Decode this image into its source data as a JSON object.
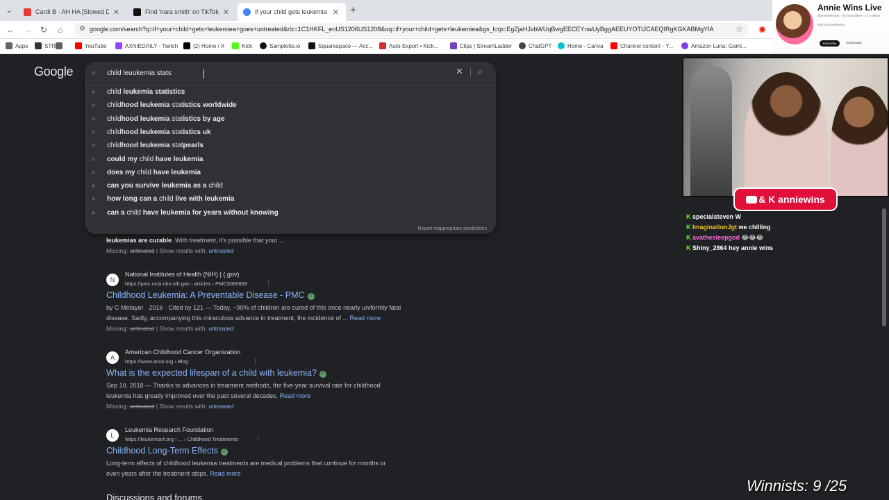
{
  "tabs": [
    {
      "title": "Cardi B - AH HA [Slowed Down",
      "color": "#e53935"
    },
    {
      "title": "Find 'nara smith' on TikTok | Tik",
      "color": "#111111"
    },
    {
      "title": "if your child gets leukemia go",
      "color": "#4285f4"
    }
  ],
  "toolbar": {
    "url": "google.com/search?q=if+your+child+gets+leukemiea+goes+untreated&rlz=1C1HKFL_enUS1206US1208&oq=if+your+child+gets+leukemiea&gs_lcrp=EgZjaHJvbWUqBwgEECEYnwUyBggAEEUYOTIJCAEQIRgKGKABMgYIA"
  },
  "bookmarks": [
    {
      "label": "Apps",
      "color": "#5f6368"
    },
    {
      "label": "STR",
      "color": "#333333"
    },
    {
      "label": "",
      "color": "#5f6368"
    },
    {
      "label": "YouTube",
      "color": "#ff0000"
    },
    {
      "label": "AXNIEDAILY - Twitch",
      "color": "#9146ff"
    },
    {
      "label": "(2) Home / X",
      "color": "#000000"
    },
    {
      "label": "Kick",
      "color": "#53fc18"
    },
    {
      "label": "Samplette.io",
      "color": "#111111"
    },
    {
      "label": "Squarespace — Acc...",
      "color": "#111111"
    },
    {
      "label": "Auto-Export • Kick...",
      "color": "#d32f2f"
    },
    {
      "label": "Clips | StreamLadder",
      "color": "#6f42c1"
    },
    {
      "label": "ChatGPT",
      "color": "#444444"
    },
    {
      "label": "Home - Canva",
      "color": "#00c4cc"
    },
    {
      "label": "Channel content - Y...",
      "color": "#ff0000"
    },
    {
      "label": "Amazon Luna: Gami...",
      "color": "#7b3fe4"
    }
  ],
  "google": {
    "logo": "Google",
    "query": "child leuukemia stats",
    "suggestions": [
      {
        "pre": "child ",
        "bold": "leukemia stat",
        "pre2": "",
        "bold2": "istics",
        "rest": ""
      },
      {
        "pre": "child",
        "bold": "hood leukemia",
        "pre2": " stat",
        "bold2": "istics worldwide",
        "rest": ""
      },
      {
        "pre": "child",
        "bold": "hood leukemia",
        "pre2": " stat",
        "bold2": "istics by age",
        "rest": ""
      },
      {
        "pre": "child",
        "bold": "hood leukemia",
        "pre2": " stat",
        "bold2": "istics uk",
        "rest": ""
      },
      {
        "pre": "child",
        "bold": "hood leukemia",
        "pre2": " stat",
        "bold2": "pearls",
        "rest": ""
      },
      {
        "pre": "",
        "bold": "could my ",
        "pre2": "child",
        "bold2": " have leukemia",
        "rest": ""
      },
      {
        "pre": "",
        "bold": "does my ",
        "pre2": "child",
        "bold2": " have leukemia",
        "rest": ""
      },
      {
        "pre": "",
        "bold": "can you survive leukemia as a ",
        "pre2": "child",
        "bold2": "",
        "rest": ""
      },
      {
        "pre": "",
        "bold": "how long can a ",
        "pre2": "child",
        "bold2": " live with leukemia",
        "rest": ""
      },
      {
        "pre": "",
        "bold": "can a ",
        "pre2": "child",
        "bold2": " have leukemia for years without knowing",
        "rest": ""
      }
    ],
    "report": "Report inappropriate predictions"
  },
  "results": {
    "top_snippet": {
      "bold": "leukemias are curable",
      "rest": ". With treatment, it's possible that your ..."
    },
    "missing_label": "Missing:",
    "missing_word": "untreated",
    "show_label": "| Show results with:",
    "items": [
      {
        "site": "National Institutes of Health (NIH) | (.gov)",
        "url": "https://pmc.ncbi.nlm.nih.gov › articles › PMC5080868",
        "title": "Childhood Leukemia: A Preventable Disease - PMC",
        "line1": "by C Metayer · 2016 · Cited by 121 — Today, ~90% of children are cured of this once nearly uniformly fatal",
        "line2": "disease. Sadly, accompanying this miraculous advance in treatment, the incidence of ...",
        "fav": "N"
      },
      {
        "site": "American Childhood Cancer Organization",
        "url": "https://www.acco.org › Blog",
        "title": "What is the expected lifespan of a child with leukemia?",
        "line1": "Sep 10, 2018 — Thanks to advances in treatment methods, the five-year survival rate for childhood",
        "line2": "leukemia has greatly improved over the past several decades.",
        "fav": "A"
      },
      {
        "site": "Leukemia Research Foundation",
        "url": "https://leukemiarf.org › ... › Childhood Treatments",
        "title": "Childhood Long-Term Effects",
        "line1": "Long-term effects of childhood leukemia treatments are medical problems that continue for months or",
        "line2": "even years after the treatment stops.",
        "fav": "L"
      }
    ],
    "read_more": "Read more",
    "discussions": "Discussions and forums"
  },
  "overlay": {
    "channel_name": "Annie Wins Live",
    "channel_sub": "@anniewinslive · 64 subscribers · 171 videos",
    "channel_desc": "Kick.com/anniewins",
    "subscribe": "Subscribe",
    "community": "Community",
    "cam_tag": "& K anniewins",
    "chat": [
      {
        "user": "specialsteven W",
        "msg": "",
        "color": "#ffffff"
      },
      {
        "user": "ImaginationJgt",
        "msg": "we chilling",
        "color": "#f5c518"
      },
      {
        "user": "avathesleepgod",
        "msg": "😂😂😂",
        "color": "#ff6ad5"
      },
      {
        "user": "Shiny_2864",
        "msg": "hey annie wins",
        "color": "#ffffff"
      }
    ],
    "counter": "Winnists: 9 /25"
  }
}
